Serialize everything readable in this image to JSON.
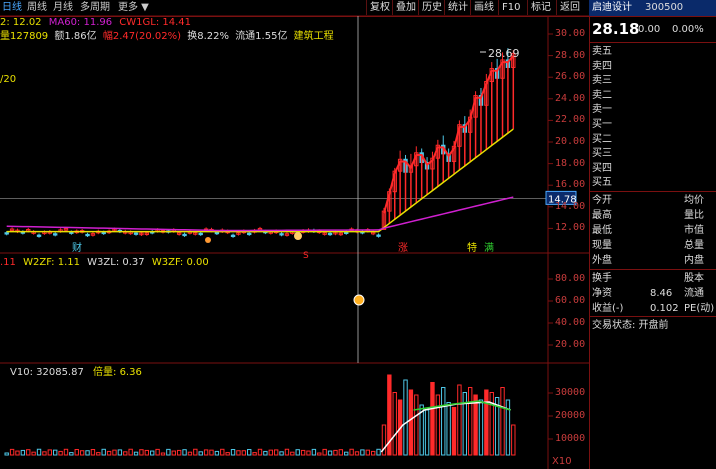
{
  "tabs": {
    "daily": "日线",
    "weekly": "周线",
    "monthly": "月线",
    "multi": "多周期",
    "more": "更多 ▼"
  },
  "toolbar": {
    "restore": "复权",
    "overlay": "叠加",
    "history": "历史",
    "stats": "统计",
    "drawline": "画线",
    "f10": "F10",
    "mark": "标记",
    "back": "返回"
  },
  "stock": {
    "name": "启迪设计",
    "code": "300500",
    "price": "28.18",
    "change": "0.00",
    "pct": "0.00%"
  },
  "main_info": {
    "ma_line": {
      "p1": "2: 12.02",
      "p2": "MA60: 11.96",
      "p3": "CW1GL: 14.41"
    },
    "vol_line": {
      "p1": "量127809",
      "p2": "额1.86亿",
      "p3": "幅2.47(20.02%)",
      "p4": "换8.22%",
      "p5": "流通1.55亿",
      "p6": "建筑工程"
    },
    "partial": "/20",
    "high_label": "28.69",
    "current_label": "14.78",
    "markers": {
      "cai": "财",
      "zhang": "涨",
      "te": "特",
      "man": "满",
      "s": "S"
    }
  },
  "ind_info": {
    "p1": ".11",
    "p2": "W2ZF: 1.11",
    "p3": "W3ZL: 0.37",
    "p4": "W3ZF: 0.00"
  },
  "vol_info": {
    "p1": "V10: 32085.87",
    "p2": "倍量: 6.36",
    "unit": "X10"
  },
  "price_axis": [
    "30.00",
    "28.00",
    "26.00",
    "24.00",
    "22.00",
    "20.00",
    "18.00",
    "16.00",
    "14.00",
    "12.00"
  ],
  "ind_axis": [
    "80.00",
    "60.00",
    "40.00",
    "20.00"
  ],
  "vol_axis": [
    "30000",
    "20000",
    "10000"
  ],
  "orderbook": {
    "sells": [
      "卖五",
      "卖四",
      "卖三",
      "卖二",
      "卖一"
    ],
    "buys": [
      "买一",
      "买二",
      "买三",
      "买四",
      "买五"
    ]
  },
  "quote": [
    [
      "今开",
      "均价"
    ],
    [
      "最高",
      "量比"
    ],
    [
      "最低",
      "市值"
    ],
    [
      "现量",
      "总量"
    ],
    [
      "外盘",
      "内盘"
    ]
  ],
  "turnover": [
    [
      "换手",
      "股本"
    ],
    [
      "净资",
      "8.46",
      "流通"
    ],
    [
      "收益(-)",
      "0.102",
      "PE(动)"
    ]
  ],
  "trade_status": "交易状态: 开盘前",
  "colors": {
    "up": "#ff2a2a",
    "down": "#4ec8e8",
    "yellow": "#e8e000",
    "magenta": "#d020d0",
    "frame": "#7a1010"
  }
}
